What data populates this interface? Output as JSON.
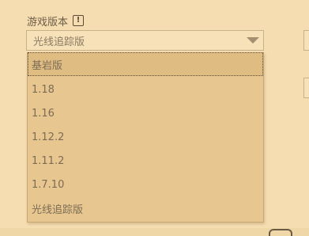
{
  "version_field": {
    "label": "游戏版本",
    "info_icon_glyph": "!",
    "info_icon": "info-icon",
    "selected_value": "光线追踪版"
  },
  "dropdown": {
    "options": [
      {
        "label": "基岩版"
      },
      {
        "label": "1.18"
      },
      {
        "label": "1.16"
      },
      {
        "label": "1.12.2"
      },
      {
        "label": "1.11.2"
      },
      {
        "label": "1.7.10"
      },
      {
        "label": "光线追踪版"
      }
    ],
    "highlighted_index": 0
  },
  "colors": {
    "background": "#f5ddb1",
    "dropdown_bg": "#e7c68f",
    "text": "#7d6c55"
  }
}
